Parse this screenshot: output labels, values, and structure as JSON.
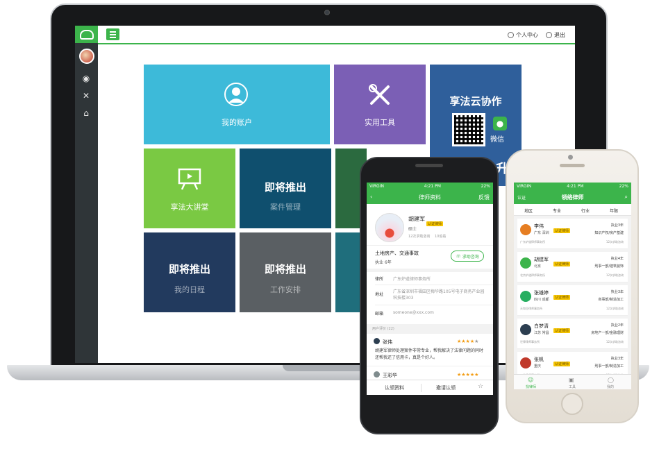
{
  "desktop": {
    "topbar": {
      "profile": "个人中心",
      "logout": "退出"
    },
    "tiles": [
      {
        "label": "我的账户",
        "bg": "#3dbad9"
      },
      {
        "label": "实用工具",
        "bg": "#7b5fb5"
      },
      {
        "title": "享法云协作",
        "wechat": "微信",
        "overlay": "升级",
        "bg": "#2f5f9b"
      },
      {
        "label": "享法大讲堂",
        "bg": "#7ac943"
      },
      {
        "coming": "即将推出",
        "label": "案件管理",
        "bg": "#0f4f6e"
      },
      {
        "bg": "#2b6a3f"
      },
      {
        "coming": "即将推出",
        "label": "我的日程",
        "bg": "#223a5e"
      },
      {
        "coming": "即将推出",
        "label": "工作安排",
        "bg": "#5a5f63"
      },
      {
        "bg": "#1f6e7c"
      }
    ]
  },
  "android": {
    "status": {
      "carrier": "VIRGIN",
      "time": "4:21 PM",
      "battery": "22%"
    },
    "nav": {
      "title": "律师资料",
      "right": "反馈"
    },
    "profile": {
      "name": "胡建军",
      "verified": "认证律师",
      "degree": "硕士",
      "consults": "12次求助咨询",
      "reviews": "10追看"
    },
    "specialty": "土地房产、交通事故",
    "years": "执业  6年",
    "consult_button": "求助咨询",
    "info": [
      {
        "key": "律所",
        "value": "广东炉道律师事务所"
      },
      {
        "key": "地址",
        "value": "广东省深圳市福田区梅华路105号电子商务产业园科技楼303"
      },
      {
        "key": "邮箱",
        "value": "someone@xxx.com"
      }
    ],
    "reviews_header": "用户评价 (22)",
    "reviews": [
      {
        "name": "张伟",
        "text": "胡建军律师处理案件非常专业，帮我解决了法律问题的同时还帮我还了信用卡，真是个好人。"
      },
      {
        "name": "王彩华"
      }
    ],
    "bottom": {
      "claim": "认领资料",
      "invite": "邀请认领"
    }
  },
  "iphone": {
    "status": {
      "carrier": "VIRGIN",
      "time": "4:21 PM",
      "battery": "22%"
    },
    "nav": {
      "title": "领络律师",
      "left": "认证"
    },
    "filters": [
      "地区",
      "专业",
      "行业",
      "年限"
    ],
    "lawyers": [
      {
        "name": "李伟",
        "verified": "认证律师",
        "loc": "广东 深圳",
        "years": "执业3年",
        "spec": "知识产权/房产基建",
        "firm": "广东炉道律师事务所",
        "consults": "12次求助咨询",
        "av": "#e67e22"
      },
      {
        "name": "胡建军",
        "verified": "认证律师",
        "loc": "北京",
        "years": "执业4年",
        "spec": "刑事一部/建筑装饰",
        "firm": "北京炉道律师事务所",
        "consults": "12次求助咨询",
        "av": "#3cb44b"
      },
      {
        "name": "张雄婷",
        "verified": "认证律师",
        "loc": "四川 成都",
        "years": "执业3年",
        "spec": "商事部/制造加工",
        "firm": "天和豆律师事务所",
        "consults": "12次求助咨询",
        "av": "#27ae60"
      },
      {
        "name": "白梦清",
        "verified": "认证律师",
        "loc": "江苏 常昌",
        "years": "执业2年",
        "spec": "房地产一部/金融理财",
        "firm": "世律律师事务所",
        "consults": "12次求助咨询",
        "av": "#2c3e50"
      },
      {
        "name": "张帆",
        "verified": "认证律师",
        "loc": "重庆",
        "years": "执业3年",
        "spec": "刑事一部/制造加工",
        "firm": "一栋律师事务所",
        "consults": "12次求助咨询",
        "av": "#c0392b"
      }
    ],
    "tabs": [
      "找律师",
      "工具",
      "我的"
    ]
  }
}
